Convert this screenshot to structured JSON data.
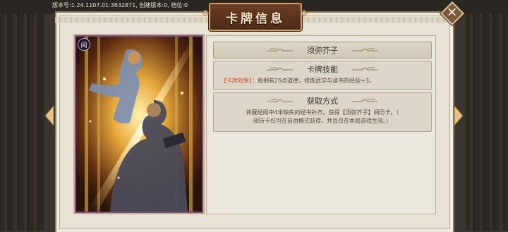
{
  "status_bar": {
    "version_text": "版本号:1.24.1107.01.3832871, 创建版本:0, 档位:0"
  },
  "window": {
    "title": "卡牌信息"
  },
  "card": {
    "badge": "阅"
  },
  "info": {
    "card_name": "须弥芥子",
    "skill_header": "卡牌技能",
    "effect_tag": "【卡牌效果】",
    "effect_text": "：每拥有25点道德，修炼武学与读书的经验+3。",
    "acquire_header": "获取方式",
    "acquire_line1": "将藏经阁中4本缺失的经书补齐。获得【须弥芥子】阅历卡。（",
    "acquire_line2": "阅历卡仅可在自由模式获得，并且仅在本局游戏生效。）"
  },
  "icons": {
    "close": "close-icon",
    "left_arrow": "left-arrow-icon",
    "right_arrow": "right-arrow-icon"
  },
  "colors": {
    "panel": "#e8e2d5",
    "title_plate": "#5a3320",
    "card_frame": "#7a4b8f",
    "effect_tag": "#c8582a",
    "arrow": "#e6c488"
  }
}
